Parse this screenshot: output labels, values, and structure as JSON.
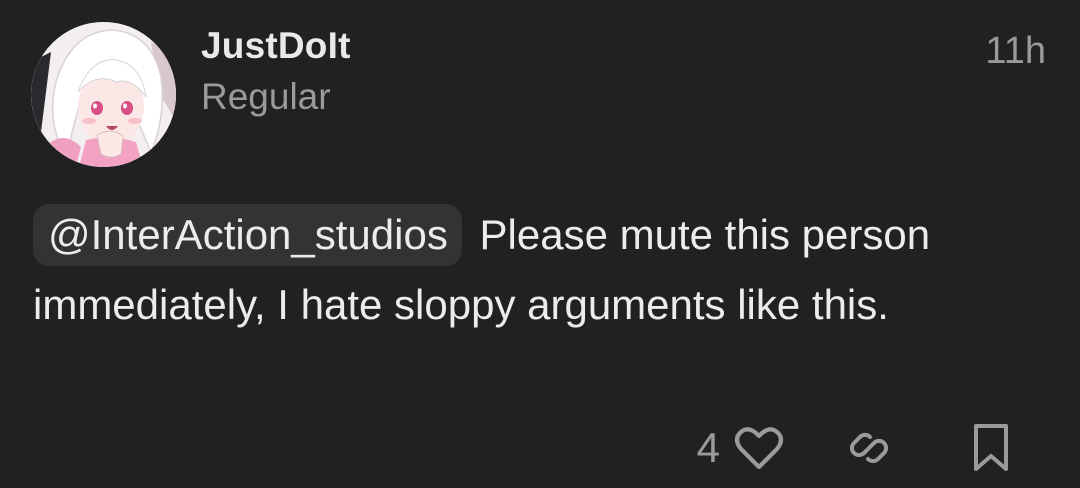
{
  "post": {
    "author": "JustDoIt",
    "role": "Regular",
    "time": "11h",
    "mention": "@InterAction_studios",
    "text": "Please mute this person immediately, I hate sloppy arguments like this.",
    "like_count": "4"
  },
  "icons": {
    "like": "heart-icon",
    "share": "link-icon",
    "save": "bookmark-icon"
  },
  "colors": {
    "background": "#212121",
    "mention_bg": "#333333",
    "muted": "#9a9a9a"
  }
}
